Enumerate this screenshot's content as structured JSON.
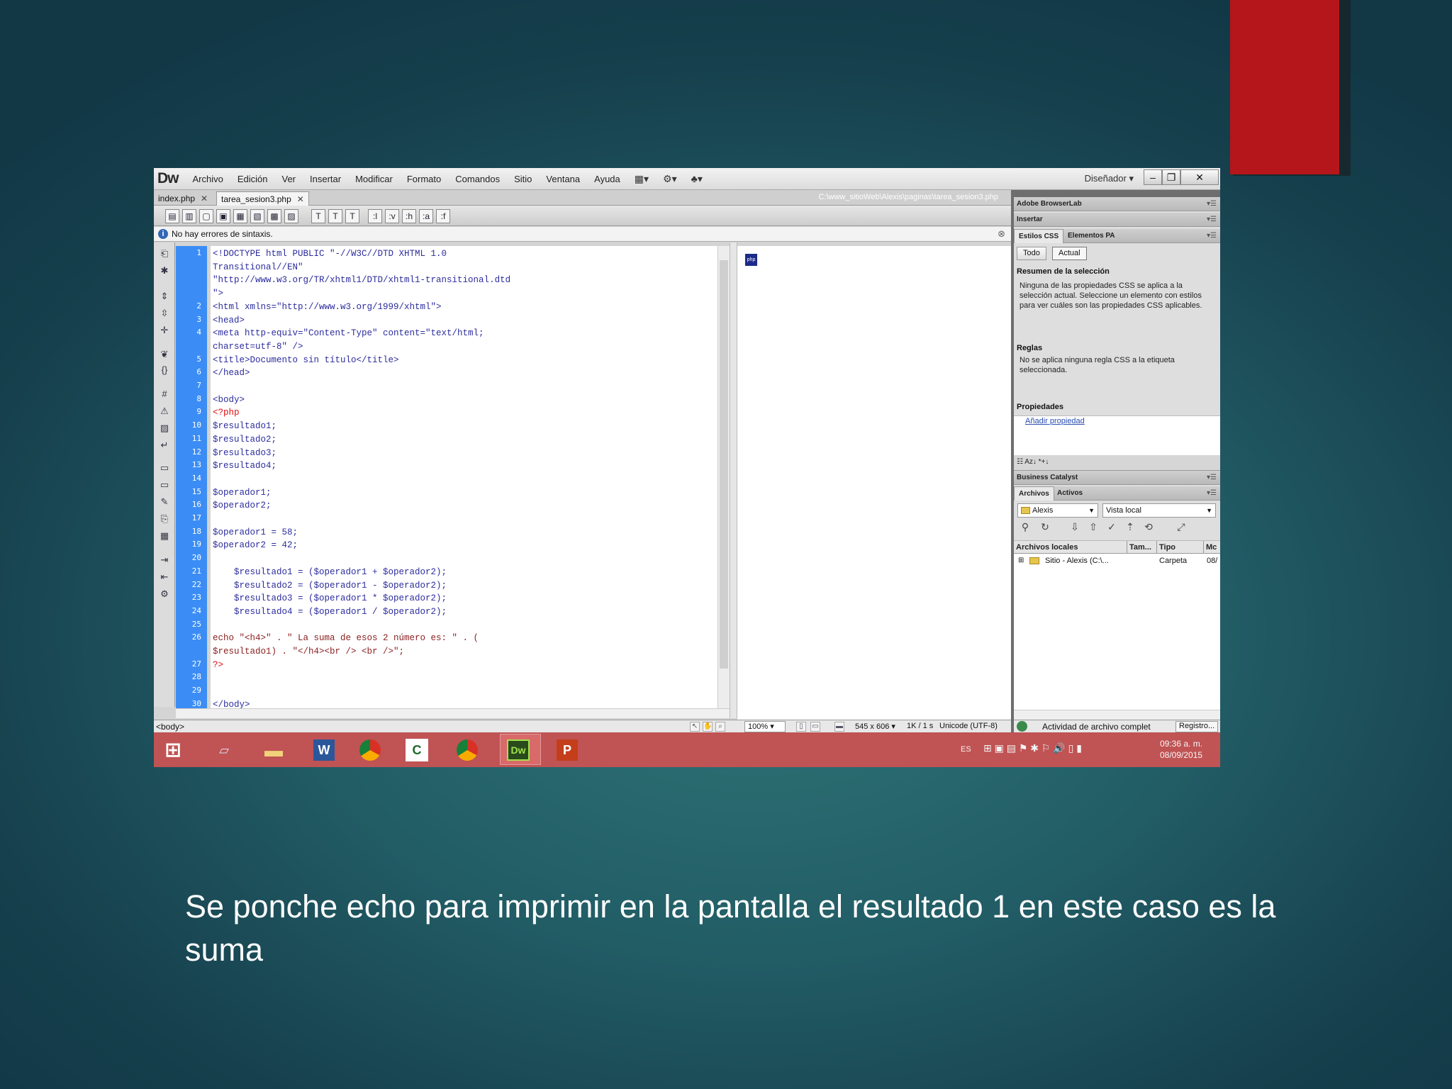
{
  "caption": "Se ponche echo para imprimir en la pantalla el resultado 1 en este caso es la suma",
  "colors": {
    "slide_background": "#1f5a63",
    "accent_bar": "#b5161b",
    "gutter": "#3b8df5",
    "taskbar": "#c05354"
  },
  "app": {
    "logo": "Dw",
    "menus": [
      "Archivo",
      "Edición",
      "Ver",
      "Insertar",
      "Modificar",
      "Formato",
      "Comandos",
      "Sitio",
      "Ventana",
      "Ayuda"
    ],
    "workspace": "Diseñador",
    "window_buttons": [
      "–",
      "❐",
      "✕"
    ]
  },
  "tabs": [
    {
      "label": "index.php"
    },
    {
      "label": "tarea_sesion3.php"
    }
  ],
  "file_path": "C:\\www_sitioWeb\\Alexis\\paginas\\tarea_sesion3.php",
  "toolbar_tags": [
    ":l",
    ":v",
    ":h",
    ":a",
    ":f"
  ],
  "message": "No hay errores de sintaxis.",
  "code_lines": [
    {
      "n": "1",
      "t": "<!DOCTYPE html PUBLIC \"-//W3C//DTD XHTML 1.0",
      "k": "html"
    },
    {
      "n": "",
      "t": "Transitional//EN\"",
      "k": "html"
    },
    {
      "n": "",
      "t": "\"http://www.w3.org/TR/xhtml1/DTD/xhtml1-transitional.dtd",
      "k": "html"
    },
    {
      "n": "",
      "t": "\">",
      "k": "html"
    },
    {
      "n": "2",
      "t": "<html xmlns=\"http://www.w3.org/1999/xhtml\">",
      "k": "html"
    },
    {
      "n": "3",
      "t": "<head>",
      "k": "html"
    },
    {
      "n": "4",
      "t": "<meta http-equiv=\"Content-Type\" content=\"text/html;",
      "k": "html"
    },
    {
      "n": "",
      "t": "charset=utf-8\" />",
      "k": "html"
    },
    {
      "n": "5",
      "t": "<title>Documento sin título</title>",
      "k": "html"
    },
    {
      "n": "6",
      "t": "</head>",
      "k": "html"
    },
    {
      "n": "7",
      "t": "",
      "k": "html"
    },
    {
      "n": "8",
      "t": "<body>",
      "k": "html"
    },
    {
      "n": "9",
      "t": "<?php",
      "k": "php"
    },
    {
      "n": "10",
      "t": "$resultado1;",
      "k": "var"
    },
    {
      "n": "11",
      "t": "$resultado2;",
      "k": "var"
    },
    {
      "n": "12",
      "t": "$resultado3;",
      "k": "var"
    },
    {
      "n": "13",
      "t": "$resultado4;",
      "k": "var"
    },
    {
      "n": "14",
      "t": "",
      "k": "var"
    },
    {
      "n": "15",
      "t": "$operador1;",
      "k": "var"
    },
    {
      "n": "16",
      "t": "$operador2;",
      "k": "var"
    },
    {
      "n": "17",
      "t": "",
      "k": "var"
    },
    {
      "n": "18",
      "t": "$operador1 = 58;",
      "k": "var"
    },
    {
      "n": "19",
      "t": "$operador2 = 42;",
      "k": "var"
    },
    {
      "n": "20",
      "t": "",
      "k": "var"
    },
    {
      "n": "21",
      "t": "    $resultado1 = ($operador1 + $operador2);",
      "k": "var"
    },
    {
      "n": "22",
      "t": "    $resultado2 = ($operador1 - $operador2);",
      "k": "var"
    },
    {
      "n": "23",
      "t": "    $resultado3 = ($operador1 * $operador2);",
      "k": "var"
    },
    {
      "n": "24",
      "t": "    $resultado4 = ($operador1 / $operador2);",
      "k": "var"
    },
    {
      "n": "25",
      "t": "",
      "k": "var"
    },
    {
      "n": "26",
      "t": "echo \"<h4>\" . \" La suma de esos 2 número es: \" . (",
      "k": "echo"
    },
    {
      "n": "",
      "t": "$resultado1) . \"</h4><br /> <br />\";",
      "k": "echo"
    },
    {
      "n": "27",
      "t": "?>",
      "k": "php"
    },
    {
      "n": "28",
      "t": "",
      "k": "html"
    },
    {
      "n": "29",
      "t": "",
      "k": "html"
    },
    {
      "n": "30",
      "t": "</body>",
      "k": "html"
    }
  ],
  "status": {
    "tag": "<body>",
    "zoom": "100%",
    "dimensions": "545 x 606 ▾",
    "size_time": "1K / 1 s",
    "encoding": "Unicode (UTF-8)"
  },
  "panels": {
    "browserlab": "Adobe BrowserLab",
    "insertar": "Insertar",
    "css_tabs": [
      "Estilos CSS",
      "Elementos PA"
    ],
    "css_buttons": [
      "Todo",
      "Actual"
    ],
    "summary_title": "Resumen de la selección",
    "summary_text": "Ninguna de las propiedades CSS se aplica a la selección actual.  Seleccione un elemento con estilos para ver cuáles son las propiedades CSS aplicables.",
    "rules_title": "Reglas",
    "rules_text": "No se aplica ninguna regla CSS a la etiqueta seleccionada.",
    "props_title": "Propiedades",
    "add_property": "Añadir propiedad",
    "business_catalyst": "Business Catalyst",
    "files_tabs": [
      "Archivos",
      "Activos"
    ],
    "site_select": "Alexis",
    "view_select": "Vista local",
    "file_columns": [
      "Archivos locales",
      "Tam...",
      "Tipo",
      "Mc"
    ],
    "file_row": {
      "name": "Sitio - Alexis (C:\\...",
      "type": "Carpeta",
      "mod": "08/"
    },
    "activity": "Actividad de archivo complet",
    "log_button": "Registro..."
  },
  "taskbar": {
    "lang": "ES",
    "time": "09:36 a. m.",
    "date": "08/09/2015",
    "app_labels": [
      "W",
      "Dw",
      "P"
    ]
  }
}
